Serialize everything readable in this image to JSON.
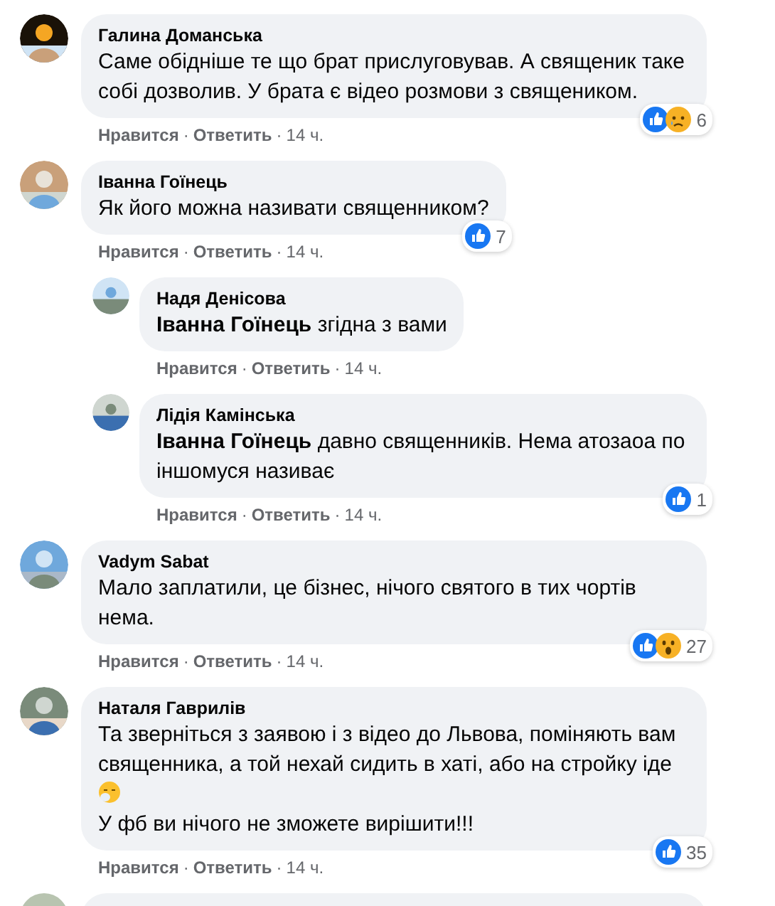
{
  "comments": [
    {
      "author": "Галина Доманська",
      "body": [
        {
          "text": "Саме обідніше те що брат прислуговував. А священик таке собі дозволив. У брата є відео розмови з священиком."
        }
      ],
      "reactions": [
        {
          "kind": "like"
        },
        {
          "kind": "sad"
        }
      ],
      "reaction_count": "6",
      "actions": [
        {
          "label": "Нравится",
          "separator": "·"
        },
        {
          "label": "Ответить",
          "separator": "·"
        }
      ],
      "time": "14 ч."
    },
    {
      "author": "Іванна Гоїнець",
      "body": [
        {
          "text": "Як його можна називати священником?"
        }
      ],
      "reactions": [
        {
          "kind": "like"
        }
      ],
      "reaction_count": "7",
      "actions": [
        {
          "label": "Нравится",
          "separator": "·"
        },
        {
          "label": "Ответить",
          "separator": "·"
        }
      ],
      "time": "14 ч.",
      "replies": [
        {
          "author": "Надя Денісова",
          "body": [
            {
              "text": "**Іванна Гоїнець** згідна з вами"
            }
          ],
          "actions": [
            {
              "label": "Нравится",
              "separator": "·"
            },
            {
              "label": "Ответить",
              "separator": "·"
            }
          ],
          "time": "14 ч."
        },
        {
          "author": "Лідія Камінська",
          "body": [
            {
              "text": "**Іванна Гоїнець** давно священників. Нема атозаоа по іншомуся називає"
            }
          ],
          "reactions": [
            {
              "kind": "like"
            }
          ],
          "reaction_count": "1",
          "actions": [
            {
              "label": "Нравится",
              "separator": "·"
            },
            {
              "label": "Ответить",
              "separator": "·"
            }
          ],
          "time": "14 ч."
        }
      ]
    },
    {
      "author": "Vadym Sabat",
      "body": [
        {
          "text": "Мало заплатили, це бізнес, нічого святого в тих чортів нема."
        }
      ],
      "reactions": [
        {
          "kind": "like"
        },
        {
          "kind": "wow"
        }
      ],
      "reaction_count": "27",
      "actions": [
        {
          "label": "Нравится",
          "separator": "·"
        },
        {
          "label": "Ответить",
          "separator": "·"
        }
      ],
      "time": "14 ч."
    },
    {
      "author": "Наталя Гаврилів",
      "body": [
        {
          "text": "Та зверніться з заявою і з відео до Львова, поміняють вам священника, а той нехай сидить в хаті, або на стройку іде",
          "emoji": {
            "kind": "sneezing"
          }
        },
        {
          "text": "У фб ви нічого не зможете вирішити!!!"
        }
      ],
      "reactions": [
        {
          "kind": "like"
        }
      ],
      "reaction_count": "35",
      "actions": [
        {
          "label": "Нравится",
          "separator": "·"
        },
        {
          "label": "Ответить",
          "separator": "·"
        }
      ],
      "time": "14 ч."
    }
  ]
}
